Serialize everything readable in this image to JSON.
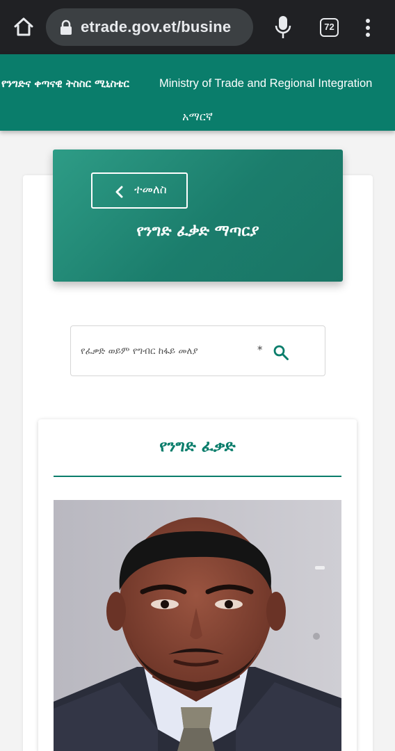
{
  "browser": {
    "url": "etrade.gov.et/busine",
    "tab_count": "72",
    "icons": [
      "home-icon",
      "lock-icon",
      "microphone-icon",
      "tabs-icon",
      "more-vert-icon"
    ]
  },
  "header": {
    "title_amharic": "የንግድና ቀጣናዊ ትስስር ሚኒስቴር",
    "title_english": "Ministry of Trade and Regional Integration",
    "language_link": "አማርኛ"
  },
  "hero": {
    "back_label": "ተመለስ",
    "title": "የንግድ ፈቃድ ማጣርያ"
  },
  "search": {
    "placeholder": "የፈቃድ ወይም የግብር ከፋይ መለያ",
    "required_mark": "*"
  },
  "license": {
    "title": "የንግድ ፈቃድ"
  },
  "colors": {
    "brand_green": "#0a7d6b",
    "hero_gradient_start": "#2e9c86",
    "hero_gradient_end": "#1a7565",
    "chrome_bar": "#202124"
  }
}
